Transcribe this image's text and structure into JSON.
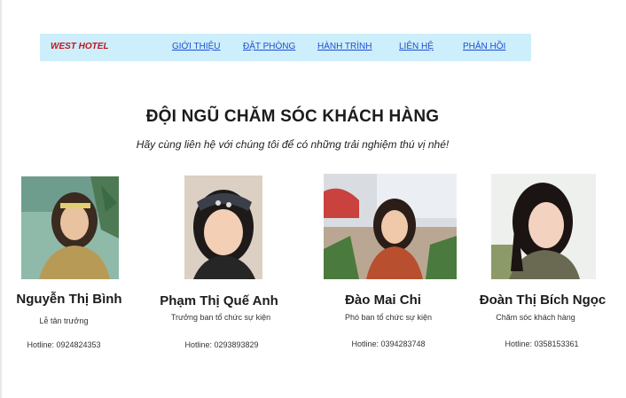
{
  "nav": {
    "brand": "WEST HOTEL",
    "links": [
      "GIỚI THIỆU",
      "ĐẶT PHÒNG",
      "HÀNH TRÌNH",
      "LIÊN HỆ",
      "PHẢN HỒI"
    ]
  },
  "section": {
    "title": "ĐỘI NGŨ CHĂM SÓC KHÁCH HÀNG",
    "subtitle": "Hãy cùng liên hệ với chúng tôi để có những trải nghiệm thú vị nhé!"
  },
  "staff": [
    {
      "name": "Nguyễn Thị Bình",
      "role": "Lễ tân trưởng",
      "hotline": "Hotline: 0924824353"
    },
    {
      "name": "Phạm Thị Quế Anh",
      "role": "Trưởng ban tổ chức sự kiện",
      "hotline": "Hotline: 0293893829"
    },
    {
      "name": "Đào Mai Chi",
      "role": "Phó ban tổ chức sự kiện",
      "hotline": "Hotline: 0394283748"
    },
    {
      "name": "Đoàn Thị Bích Ngọc",
      "role": "Chăm sóc khách hàng",
      "hotline": "Hotline: 0358153361"
    }
  ],
  "colors": {
    "nav_bg": "#cdeefb",
    "brand": "#c0161e",
    "link": "#1f4fd1"
  }
}
